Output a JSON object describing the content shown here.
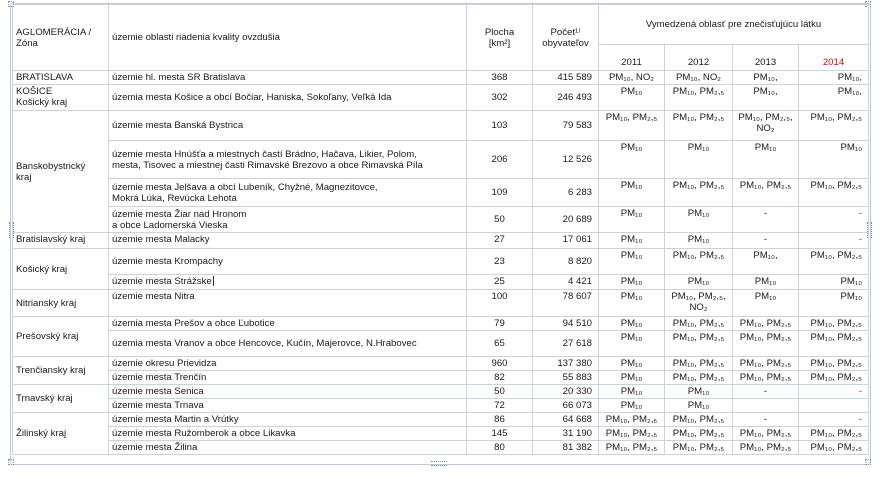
{
  "header": {
    "col1_line1": "AGLOMERÁCIA  /",
    "col1_line2": "Zóna",
    "col2": "územie oblasti riadenia kvality ovzdušia",
    "area_line1": "Plocha",
    "area_line2": "[km²]",
    "pop_line1": "Počet¹⁾",
    "pop_line2": "obyvateľov",
    "vymedzena": "Vymedzená oblasť pre znečisťujúcu látku",
    "years": [
      "2011",
      "2012",
      "2013",
      "2014"
    ]
  },
  "rows": {
    "r1": {
      "territory": "územie hl. mesta SR Bratislava",
      "area": "368",
      "population": "415 589",
      "y2011": "PM₁₀, NO₂",
      "y2012": "PM₁₀, NO₂",
      "y2013": "PM₁₀,",
      "y2014": "PM₁₀,"
    },
    "r2": {
      "territory": "územia mesta Košice a obcí Bočiar, Haniska, Sokoľany, Veľká Ida",
      "area": "302",
      "population": "246 493",
      "y2011": "PM₁₀",
      "y2012": "PM₁₀, PM₂,₅",
      "y2013": "PM₁₀,",
      "y2014": "PM₁₀,"
    },
    "r3": {
      "territory": "územie mesta Banská Bystrica",
      "area": "103",
      "population": "79 583",
      "y2011": "PM₁₀, PM₂,₅",
      "y2012": "PM₁₀, PM₂,₅",
      "y2013_l1": "PM₁₀, PM₂,₅,",
      "y2013_l2": "NO₂",
      "y2014": "PM₁₀, PM₂,₅"
    },
    "r4": {
      "territory_l1": "územie mesta Hnúšťa a miestnych častí Brádno, Hačava, Likier, Polom,",
      "territory_l2": "mesta, Tisovec a miestnej časti Rimavské  Brezovo a obce Rimavská Píla",
      "area": "206",
      "population": "12 526",
      "y2011": "PM₁₀",
      "y2012": "PM₁₀",
      "y2013": "PM₁₀",
      "y2014": "PM₁₀"
    },
    "r5": {
      "territory_l1": "územie mesta Jelšava a obcí Lubeník, Chyžné, Magnezitovce,",
      "territory_l2": "Mokrá Lúka, Revúcka Lehota",
      "area": "109",
      "population": "6 283",
      "y2011": "PM₁₀",
      "y2012": "PM₁₀, PM₂,₅",
      "y2013": "PM₁₀, PM₂,₅",
      "y2014": "PM₁₀, PM₂,₅"
    },
    "r6": {
      "territory_l1": "územie mesta Žiar nad  Hronom",
      "territory_l2": "a obce Ladomerská Vieska",
      "area": "50",
      "population": "20 689",
      "y2011": "PM₁₀",
      "y2012": "PM₁₀",
      "y2013": "-",
      "y2014": "-"
    },
    "r7": {
      "territory": "územie mesta Malacky",
      "area": "27",
      "population": "17 061",
      "y2011": "PM₁₀",
      "y2012": "PM₁₀",
      "y2013": "-",
      "y2014": "-"
    },
    "r8": {
      "territory": "územie mesta Krompachy",
      "area": "23",
      "population": "8 820",
      "y2011": "PM₁₀",
      "y2012": "PM₁₀, PM₂,₅",
      "y2013": "PM₁₀,",
      "y2014": "PM₁₀, PM₂,₅"
    },
    "r9": {
      "territory": "územie mesta Strážske",
      "area": "25",
      "population": "4 421",
      "y2011": "PM₁₀",
      "y2012": "PM₁₀",
      "y2013": "PM₁₀",
      "y2014": "PM₁₀"
    },
    "r10": {
      "territory": "územie mesta Nitra",
      "area": "100",
      "population": "78 607",
      "y2011": "PM₁₀",
      "y2012_l1": "PM₁₀, PM₂,₅,",
      "y2012_l2": "NO₂",
      "y2013": "PM₁₀",
      "y2014": "PM₁₀"
    },
    "r11": {
      "territory": "územia mesta Prešov a obce Ľubotice",
      "area": "79",
      "population": "94 510",
      "y2011": "PM₁₀",
      "y2012": "PM₁₀, PM₂,₅",
      "y2013": "PM₁₀, PM₂,₅",
      "y2014": "PM₁₀, PM₂,₅"
    },
    "r12": {
      "territory": "územia mesta Vranov a obce Hencovce, Kučín, Majerovce, N.Hrabovec",
      "area": "65",
      "population": "27 618",
      "y2011": "PM₁₀",
      "y2012": "PM₁₀, PM₂,₅",
      "y2013": "PM₁₀, PM₂,₅",
      "y2014": "PM₁₀, PM₂,₅"
    },
    "r13": {
      "territory": "územie okresu Prievidza",
      "area": "960",
      "population": "137 380",
      "y2011": "PM₁₀",
      "y2012": "PM₁₀, PM₂,₅",
      "y2013": "PM₁₀, PM₂,₅",
      "y2014": "PM₁₀, PM₂,₅"
    },
    "r14": {
      "territory": "územie mesta Trenčín",
      "area": "82",
      "population": "55 883",
      "y2011": "PM₁₀",
      "y2012": "PM₁₀, PM₂,₅",
      "y2013": "PM₁₀, PM₂,₅",
      "y2014": "PM₁₀, PM₂,₅"
    },
    "r15": {
      "territory": "územie mesta Senica",
      "area": "50",
      "population": "20 330",
      "y2011": "PM₁₀",
      "y2012": "PM₁₀",
      "y2013": "-",
      "y2014": "-"
    },
    "r16": {
      "territory": "územie mesta Trnava",
      "area": "72",
      "population": "66 073",
      "y2011": "PM₁₀",
      "y2012": "PM₁₀",
      "y2013": "",
      "y2014": ""
    },
    "r17": {
      "territory": "územie mesta Martin a Vrútky",
      "area": "86",
      "population": "64 668",
      "y2011": "PM₁₀, PM₂,₅",
      "y2012": "PM₁₀, PM₂,₅",
      "y2013": "-",
      "y2014": "-"
    },
    "r18": {
      "territory": "územie mesta Ružomberok a obce Likavka",
      "area": "145",
      "population": "31 190",
      "y2011": "PM₁₀, PM₂,₅",
      "y2012": "PM₁₀, PM₂,₅",
      "y2013": "PM₁₀, PM₂,₅",
      "y2014": "PM₁₀, PM₂,₅"
    },
    "r19": {
      "territory": "územie mesta Žilina",
      "area": "80",
      "population": "81 382",
      "y2011": "PM₁₀, PM₂,₅",
      "y2012": "PM₁₀, PM₂,₅",
      "y2013": "PM₁₀, PM₂,₅",
      "y2014": "PM₁₀, PM₂,₅"
    }
  },
  "zones": {
    "bratislava": "BRATISLAVA",
    "kosice_l1": "KOŠICE",
    "kosice_l2": "Košický kraj",
    "banskobystricky_l1": "Banskobystrický",
    "banskobystricky_l2": "kraj",
    "bratislavsky": "Bratislavský kraj",
    "kosicky": "Košický kraj",
    "nitriansky": "Nitriansky kraj",
    "presovsky": "Prešovský kraj",
    "trenciansky": "Trenčiansky kraj",
    "trnavsky": "Trnavský  kraj",
    "zilinsky": "Žilinský kraj"
  },
  "colors": {
    "accent_red": "#cc1111",
    "grid": "#c9d4df",
    "frame": "#bcc9d6"
  }
}
